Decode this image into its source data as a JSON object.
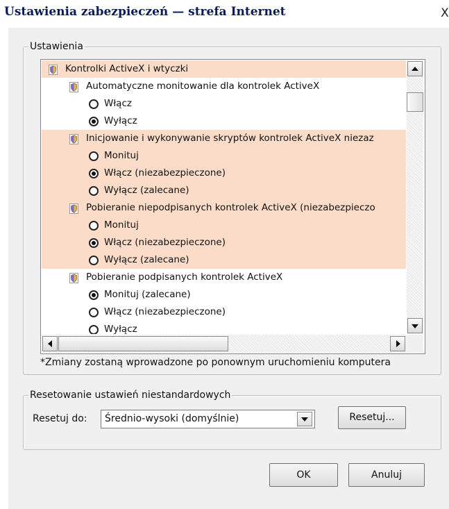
{
  "window": {
    "title": "Ustawienia zabezpieczeń — strefa Internet",
    "close_label": "X"
  },
  "settings_group": {
    "label": "Ustawienia",
    "items": [
      {
        "kind": "header",
        "text": "Kontrolki ActiveX i wtyczki",
        "highlight": true
      },
      {
        "kind": "setting",
        "text": "Automatyczne monitowanie dla kontrolek ActiveX",
        "highlight": false
      },
      {
        "kind": "option",
        "text": "Włącz",
        "checked": false,
        "highlight": false
      },
      {
        "kind": "option",
        "text": "Wyłącz",
        "checked": true,
        "highlight": false
      },
      {
        "kind": "setting",
        "text": "Inicjowanie i wykonywanie skryptów kontrolek ActiveX niezaz",
        "highlight": true
      },
      {
        "kind": "option",
        "text": "Monituj",
        "checked": false,
        "highlight": true
      },
      {
        "kind": "option",
        "text": "Włącz (niezabezpieczone)",
        "checked": true,
        "highlight": true
      },
      {
        "kind": "option",
        "text": "Wyłącz (zalecane)",
        "checked": false,
        "highlight": true
      },
      {
        "kind": "setting",
        "text": "Pobieranie niepodpisanych kontrolek ActiveX (niezabezpieczo",
        "highlight": true
      },
      {
        "kind": "option",
        "text": "Monituj",
        "checked": false,
        "highlight": true
      },
      {
        "kind": "option",
        "text": "Włącz (niezabezpieczone)",
        "checked": true,
        "highlight": true
      },
      {
        "kind": "option",
        "text": "Wyłącz (zalecane)",
        "checked": false,
        "highlight": true
      },
      {
        "kind": "setting",
        "text": "Pobieranie podpisanych kontrolek ActiveX",
        "highlight": false
      },
      {
        "kind": "option",
        "text": "Monituj (zalecane)",
        "checked": true,
        "highlight": false
      },
      {
        "kind": "option",
        "text": "Włącz (niezabezpieczone)",
        "checked": false,
        "highlight": false
      },
      {
        "kind": "option",
        "text": "Wyłącz",
        "checked": false,
        "highlight": false
      }
    ],
    "note": "*Zmiany zostaną wprowadzone po ponownym uruchomieniu komputera"
  },
  "reset_group": {
    "label": "Resetowanie ustawień niestandardowych",
    "reset_to_label": "Resetuj do:",
    "selected_level": "Średnio-wysoki (domyślnie)",
    "reset_button": "Resetuj..."
  },
  "footer": {
    "ok_button": "OK",
    "cancel_button": "Anuluj"
  },
  "colors": {
    "highlight": "#fbdcc8",
    "title_text": "#0b1a5a"
  },
  "icons": {
    "setting": "shield-icon",
    "option": "radio-button"
  }
}
